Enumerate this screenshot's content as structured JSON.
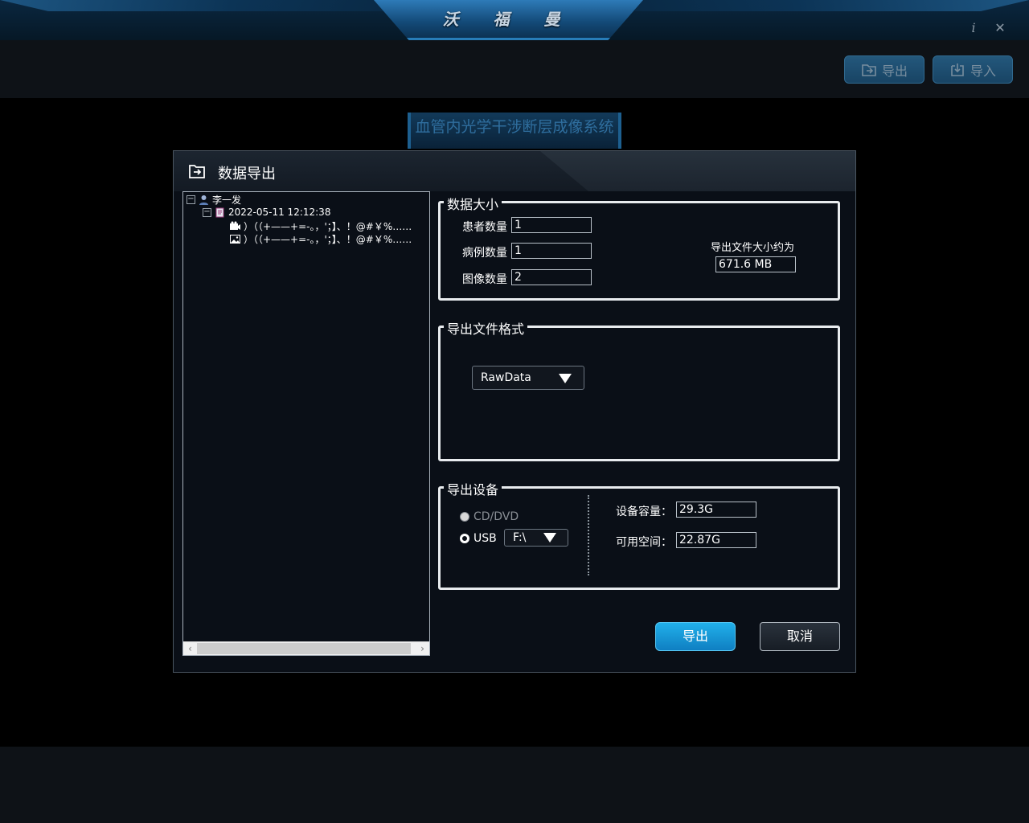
{
  "app": {
    "brand": "沃 福 曼",
    "system_title": "血管内光学干涉断层成像系统"
  },
  "toolbar": {
    "export_label": "导出",
    "import_label": "导入"
  },
  "dialog": {
    "title": "数据导出",
    "tree": {
      "patient": "李一发",
      "case_date": "2022-05-11 12:12:38",
      "items": [
        {
          "icon": "video-icon",
          "text": "）（（+——+=-。，'；】、！@#￥%……"
        },
        {
          "icon": "image-icon",
          "text": "）（（+——+=-。，'；】、！@#￥%……"
        }
      ]
    },
    "data_size": {
      "title": "数据大小",
      "patients_label": "患者数量",
      "patients_value": "1",
      "cases_label": "病例数量",
      "cases_value": "1",
      "images_label": "图像数量",
      "images_value": "2",
      "file_size_label": "导出文件大小约为",
      "file_size_value": "671.6 MB"
    },
    "format": {
      "title": "导出文件格式",
      "selected": "RawData"
    },
    "device": {
      "title": "导出设备",
      "cd_label": "CD/DVD",
      "usb_label": "USB",
      "usb_selected": true,
      "cd_enabled": false,
      "drive": "F:\\",
      "capacity_label": "设备容量：",
      "capacity_value": "29.3G",
      "free_label": "可用空间：",
      "free_value": "22.87G"
    },
    "export_button": "导出",
    "cancel_button": "取消"
  }
}
